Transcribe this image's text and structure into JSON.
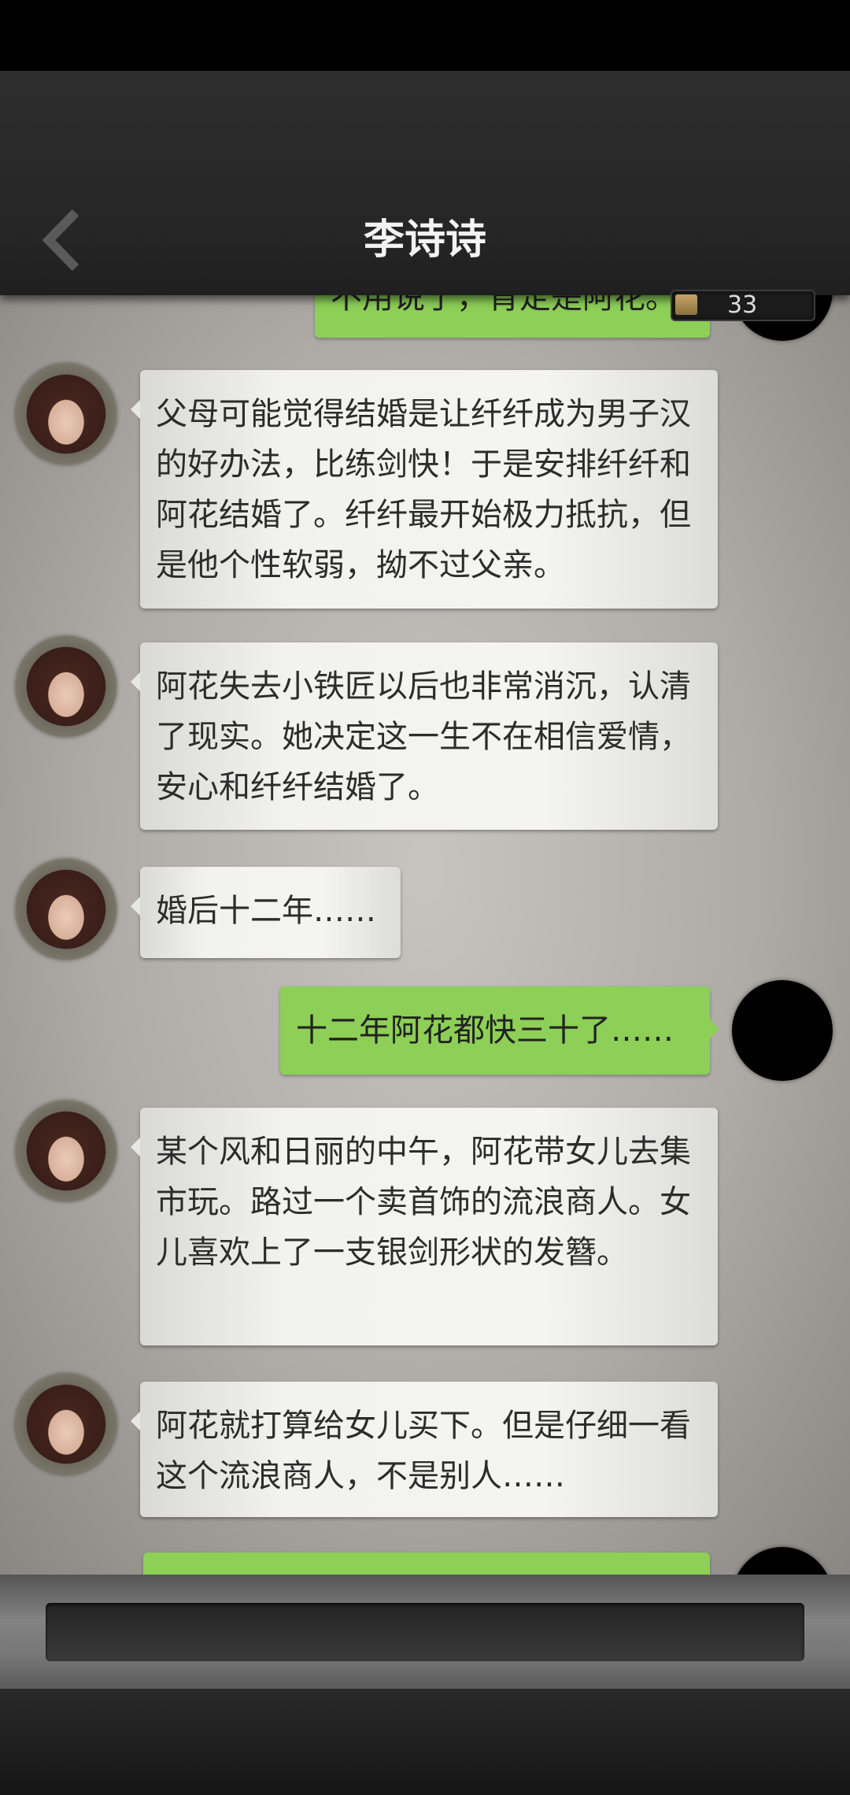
{
  "header": {
    "title": "李诗诗",
    "counter_value": "33"
  },
  "messages": [
    {
      "side": "right",
      "text": "不用说了，肯定是阿花。"
    },
    {
      "side": "left",
      "text": "父母可能觉得结婚是让纤纤成为男子汉的好办法，比练剑快！于是安排纤纤和阿花结婚了。纤纤最开始极力抵抗，但是他个性软弱，拗不过父亲。"
    },
    {
      "side": "left",
      "text": "阿花失去小铁匠以后也非常消沉，认清了现实。她决定这一生不在相信爱情，安心和纤纤结婚了。"
    },
    {
      "side": "left",
      "text": "婚后十二年……"
    },
    {
      "side": "right",
      "text": "十二年阿花都快三十了……"
    },
    {
      "side": "left",
      "text": "某个风和日丽的中午，阿花带女儿去集市玩。路过一个卖首饰的流浪商人。女儿喜欢上了一支银剑形状的发簪。"
    },
    {
      "side": "left",
      "text": "阿花就打算给女儿买下。但是仔细一看这个流浪商人，不是别人……"
    },
    {
      "side": "right",
      "text": ""
    }
  ],
  "colors": {
    "user_bubble": "#8dcf57",
    "npc_bubble": "#f2f2ee",
    "header_bg": "#2a2a2a"
  },
  "icons": {
    "back": "chevron-left-icon",
    "counter": "coin-icon"
  }
}
